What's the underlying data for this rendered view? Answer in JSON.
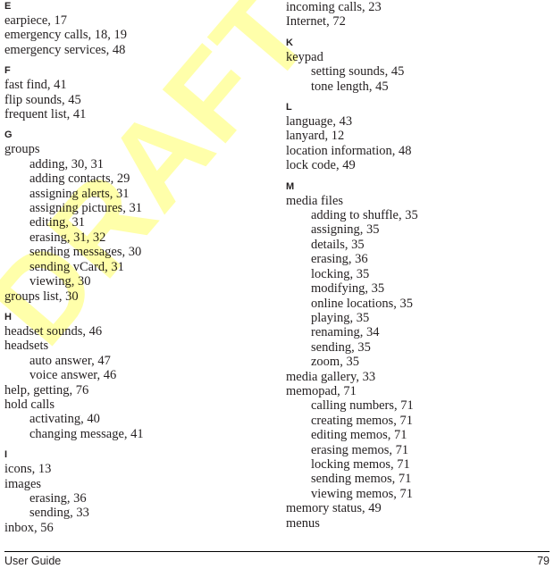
{
  "document": {
    "type": "index",
    "watermark": "DRAFT",
    "watermark_color": "#ffffaa"
  },
  "footer": {
    "title": "User Guide",
    "page_number": "79"
  },
  "columns": [
    {
      "id": "left",
      "blocks": [
        {
          "letter": "E",
          "entries": [
            {
              "level": 1,
              "text": "earpiece, 17"
            },
            {
              "level": 1,
              "text": "emergency calls, 18, 19"
            },
            {
              "level": 1,
              "text": "emergency services, 48"
            }
          ]
        },
        {
          "letter": "F",
          "entries": [
            {
              "level": 1,
              "text": "fast find, 41"
            },
            {
              "level": 1,
              "text": "flip sounds, 45"
            },
            {
              "level": 1,
              "text": "frequent list, 41"
            }
          ]
        },
        {
          "letter": "G",
          "entries": [
            {
              "level": 1,
              "text": "groups"
            },
            {
              "level": 2,
              "text": "adding, 30, 31"
            },
            {
              "level": 2,
              "text": "adding contacts, 29"
            },
            {
              "level": 2,
              "text": "assigning alerts, 31"
            },
            {
              "level": 2,
              "text": "assigning pictures, 31"
            },
            {
              "level": 2,
              "text": "editing, 31"
            },
            {
              "level": 2,
              "text": "erasing, 31, 32"
            },
            {
              "level": 2,
              "text": "sending messages, 30"
            },
            {
              "level": 2,
              "text": "sending vCard, 31"
            },
            {
              "level": 2,
              "text": "viewing, 30"
            },
            {
              "level": 1,
              "text": "groups list, 30"
            }
          ]
        },
        {
          "letter": "H",
          "entries": [
            {
              "level": 1,
              "text": "headset sounds, 46"
            },
            {
              "level": 1,
              "text": "headsets"
            },
            {
              "level": 2,
              "text": "auto answer, 47"
            },
            {
              "level": 2,
              "text": "voice answer, 46"
            },
            {
              "level": 1,
              "text": "help, getting, 76"
            },
            {
              "level": 1,
              "text": "hold calls"
            },
            {
              "level": 2,
              "text": "activating, 40"
            },
            {
              "level": 2,
              "text": "changing message, 41"
            }
          ]
        },
        {
          "letter": "I",
          "entries": [
            {
              "level": 1,
              "text": "icons, 13"
            },
            {
              "level": 1,
              "text": "images"
            },
            {
              "level": 2,
              "text": "erasing, 36"
            },
            {
              "level": 2,
              "text": "sending, 33"
            },
            {
              "level": 1,
              "text": "inbox, 56"
            }
          ]
        }
      ]
    },
    {
      "id": "right",
      "blocks": [
        {
          "letter": "",
          "continued": true,
          "entries": [
            {
              "level": 1,
              "text": "incoming calls, 23"
            },
            {
              "level": 1,
              "text": "Internet, 72"
            }
          ]
        },
        {
          "letter": "K",
          "entries": [
            {
              "level": 1,
              "text": "keypad"
            },
            {
              "level": 2,
              "text": "setting sounds, 45"
            },
            {
              "level": 2,
              "text": "tone length, 45"
            }
          ]
        },
        {
          "letter": "L",
          "entries": [
            {
              "level": 1,
              "text": "language, 43"
            },
            {
              "level": 1,
              "text": "lanyard, 12"
            },
            {
              "level": 1,
              "text": "location information, 48"
            },
            {
              "level": 1,
              "text": "lock code, 49"
            }
          ]
        },
        {
          "letter": "M",
          "entries": [
            {
              "level": 1,
              "text": "media files"
            },
            {
              "level": 2,
              "text": "adding to shuffle, 35"
            },
            {
              "level": 2,
              "text": "assigning, 35"
            },
            {
              "level": 2,
              "text": "details, 35"
            },
            {
              "level": 2,
              "text": "erasing, 36"
            },
            {
              "level": 2,
              "text": "locking, 35"
            },
            {
              "level": 2,
              "text": "modifying, 35"
            },
            {
              "level": 2,
              "text": "online locations, 35"
            },
            {
              "level": 2,
              "text": "playing, 35"
            },
            {
              "level": 2,
              "text": "renaming, 34"
            },
            {
              "level": 2,
              "text": "sending, 35"
            },
            {
              "level": 2,
              "text": "zoom, 35"
            },
            {
              "level": 1,
              "text": "media gallery, 33"
            },
            {
              "level": 1,
              "text": "memopad, 71"
            },
            {
              "level": 2,
              "text": "calling numbers, 71"
            },
            {
              "level": 2,
              "text": "creating memos, 71"
            },
            {
              "level": 2,
              "text": "editing memos, 71"
            },
            {
              "level": 2,
              "text": "erasing memos, 71"
            },
            {
              "level": 2,
              "text": "locking memos, 71"
            },
            {
              "level": 2,
              "text": "sending memos, 71"
            },
            {
              "level": 2,
              "text": "viewing memos, 71"
            },
            {
              "level": 1,
              "text": "memory status, 49"
            },
            {
              "level": 1,
              "text": "menus"
            }
          ]
        }
      ]
    }
  ]
}
